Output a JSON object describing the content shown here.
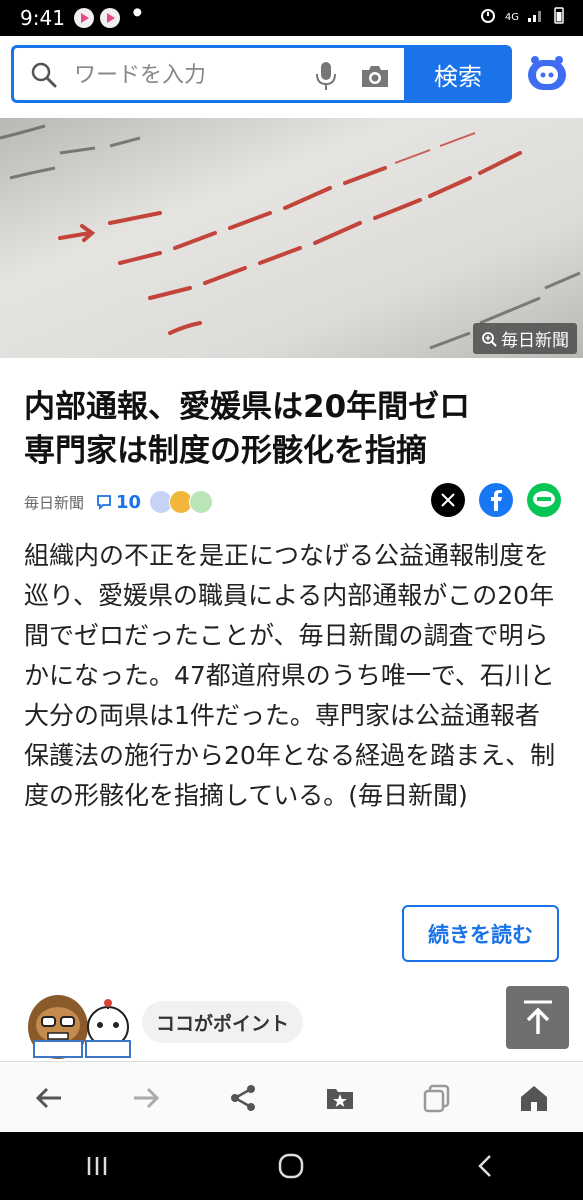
{
  "status_bar": {
    "time": "9:41",
    "network": "4G",
    "icons": [
      "play-app-icon",
      "play-app-icon",
      "wrench-icon",
      "alarm-icon",
      "signal-icon",
      "battery-icon"
    ]
  },
  "search": {
    "placeholder": "ワードを入力",
    "button_label": "検索"
  },
  "hero": {
    "credit": "毎日新聞"
  },
  "article": {
    "headline_line1": "内部通報、愛媛県は20年間ゼロ",
    "headline_line2": "専門家は制度の形骸化を指摘",
    "source": "毎日新聞",
    "comment_count": "10",
    "body": "組織内の不正を是正につなげる公益通報制度を巡り、愛媛県の職員による内部通報がこの20年間でゼロだったことが、毎日新聞の調査で明らかになった。47都道府県のうち唯一で、石川と大分の両県は1件だった。専門家は公益通報者保護法の施行から20年となる経過を踏まえ、制度の形骸化を指摘している。(毎日新聞)",
    "read_more_label": "続きを読む"
  },
  "point": {
    "label": "ココがポイント"
  },
  "colors": {
    "accent": "#1a73e8",
    "x_brand": "#000000",
    "facebook": "#1877f2",
    "line": "#06c755"
  }
}
